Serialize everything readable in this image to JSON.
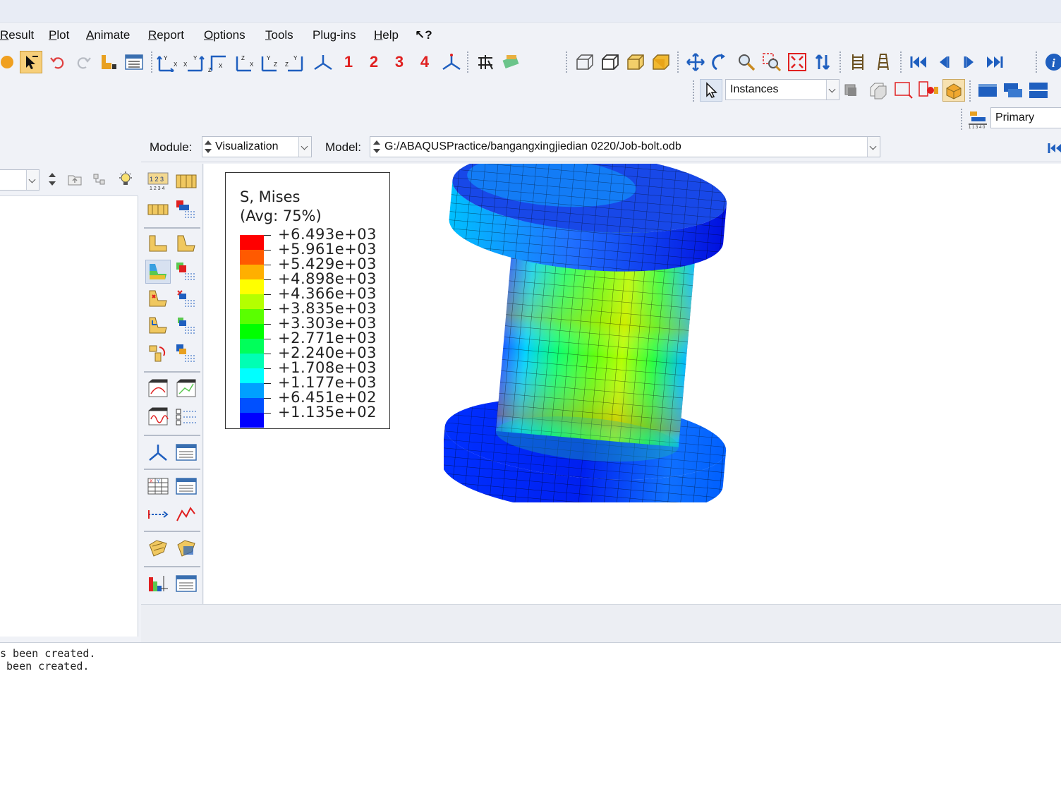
{
  "menu": {
    "items": [
      {
        "label": "Result",
        "mnemonic": "R"
      },
      {
        "label": "Plot",
        "mnemonic": "P"
      },
      {
        "label": "Animate",
        "mnemonic": "A"
      },
      {
        "label": "Report",
        "mnemonic": "R"
      },
      {
        "label": "Options",
        "mnemonic": "O"
      },
      {
        "label": "Tools",
        "mnemonic": "T"
      },
      {
        "label": "Plug-ins",
        "mnemonic": "g"
      },
      {
        "label": "Help",
        "mnemonic": "H"
      },
      {
        "label": "↖?",
        "mnemonic": ""
      }
    ]
  },
  "toolbar": {
    "view_numbers": [
      "1",
      "2",
      "3",
      "4"
    ],
    "selection_filter": "Instances",
    "csys": "Primary"
  },
  "context": {
    "module_label": "Module:",
    "module_value": "Visualization",
    "model_label": "Model:",
    "model_value": "G:/ABAQUSPractice/bangangxingjiedian 0220/Job-bolt.odb"
  },
  "legend": {
    "title": "S, Mises",
    "subtitle": "(Avg: 75%)",
    "values": [
      "+6.493e+03",
      "+5.961e+03",
      "+5.429e+03",
      "+4.898e+03",
      "+4.366e+03",
      "+3.835e+03",
      "+3.303e+03",
      "+2.771e+03",
      "+2.240e+03",
      "+1.708e+03",
      "+1.177e+03",
      "+6.451e+02",
      "+1.135e+02"
    ],
    "colors": [
      "#ff0000",
      "#ff5a00",
      "#ffaf00",
      "#ffff00",
      "#b4ff00",
      "#5aff00",
      "#00ff00",
      "#00ff5a",
      "#00ffb4",
      "#00ffff",
      "#00a0ff",
      "#0050ff",
      "#0000ff"
    ]
  },
  "messages": {
    "line1": "s been created.",
    "line2": " been created."
  },
  "colors": {
    "accent": "#1f5fbf",
    "background": "#f0f2f7"
  }
}
